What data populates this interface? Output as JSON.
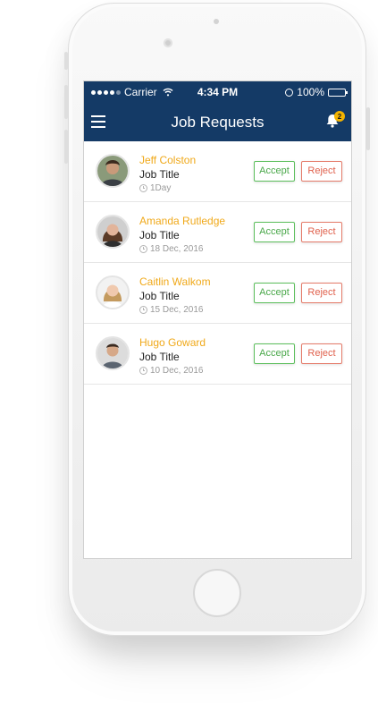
{
  "status_bar": {
    "carrier": "Carrier",
    "time": "4:34 PM",
    "battery": "100%"
  },
  "header": {
    "title": "Job Requests",
    "notification_count": "2"
  },
  "requests": [
    {
      "name": "Jeff Colston",
      "job_title": "Job Title",
      "date": "1Day",
      "accept_label": "Accept",
      "reject_label": "Reject"
    },
    {
      "name": "Amanda Rutledge",
      "job_title": "Job Title",
      "date": "18 Dec, 2016",
      "accept_label": "Accept",
      "reject_label": "Reject"
    },
    {
      "name": "Caitlin Walkom",
      "job_title": "Job Title",
      "date": "15 Dec, 2016",
      "accept_label": "Accept",
      "reject_label": "Reject"
    },
    {
      "name": "Hugo Goward",
      "job_title": "Job Title",
      "date": "10 Dec, 2016",
      "accept_label": "Accept",
      "reject_label": "Reject"
    }
  ],
  "colors": {
    "header_bg": "#143a66",
    "name_color": "#f0a91a",
    "accept_color": "#4aa84a",
    "reject_color": "#e0614d",
    "badge_color": "#f4b400"
  }
}
